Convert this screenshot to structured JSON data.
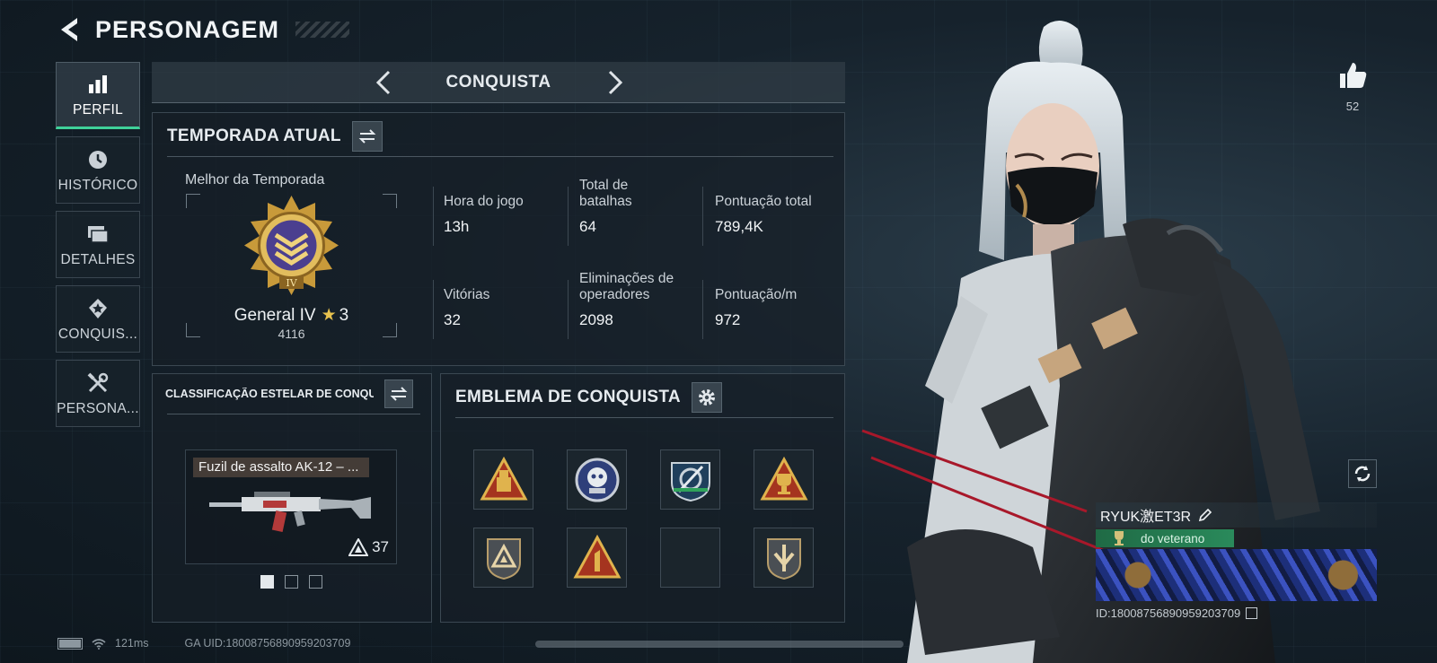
{
  "header": {
    "title": "PERSONAGEM"
  },
  "sidebar": {
    "items": [
      {
        "label": "PERFIL",
        "icon": "bar-chart-icon",
        "active": true
      },
      {
        "label": "HISTÓRICO",
        "icon": "clock-icon",
        "active": false
      },
      {
        "label": "DETALHES",
        "icon": "folders-icon",
        "active": false
      },
      {
        "label": "CONQUIS...",
        "icon": "medal-icon",
        "active": false
      },
      {
        "label": "PERSONA...",
        "icon": "tools-icon",
        "active": false
      }
    ]
  },
  "tabbar": {
    "title": "CONQUISTA"
  },
  "season": {
    "title": "TEMPORADA ATUAL",
    "best_label": "Melhor da Temporada",
    "rank_name": "General IV",
    "rank_stars": "3",
    "rank_points": "4116",
    "stats": [
      {
        "label": "Hora do jogo",
        "value": "13h"
      },
      {
        "label": "Total de batalhas",
        "value": "64"
      },
      {
        "label": "Pontuação total",
        "value": "789,4K"
      },
      {
        "label": "Vitórias",
        "value": "32"
      },
      {
        "label": "Eliminações de operadores",
        "value": "2098"
      },
      {
        "label": "Pontuação/m",
        "value": "972"
      }
    ]
  },
  "star_rating": {
    "title": "CLASSIFICAÇÃO ESTELAR DE CONQUISTA",
    "weapon_name": "Fuzil de assalto AK-12 – ...",
    "weapon_level": "37",
    "pages": 3,
    "current_page": 1
  },
  "emblems": {
    "title": "EMBLEMA DE CONQUISTA",
    "items": [
      "triangle-emblem-icon",
      "skull-shield-emblem-icon",
      "crest-emblem-icon",
      "trophy-triangle-emblem-icon",
      "shield-triangle-emblem-icon",
      "number-one-emblem-icon",
      "",
      "arrow-shield-emblem-icon"
    ]
  },
  "profile": {
    "likes": "52",
    "player_name": "RYUK激ET3R",
    "player_title": "do veterano",
    "player_id": "ID:18008756890959203709"
  },
  "status_bar": {
    "ping": "121ms",
    "uid": "GA UID:18008756890959203709"
  },
  "colors": {
    "accent": "#3fd19a",
    "gold": "#e7c24e",
    "title_green": "#2a8a5b"
  }
}
